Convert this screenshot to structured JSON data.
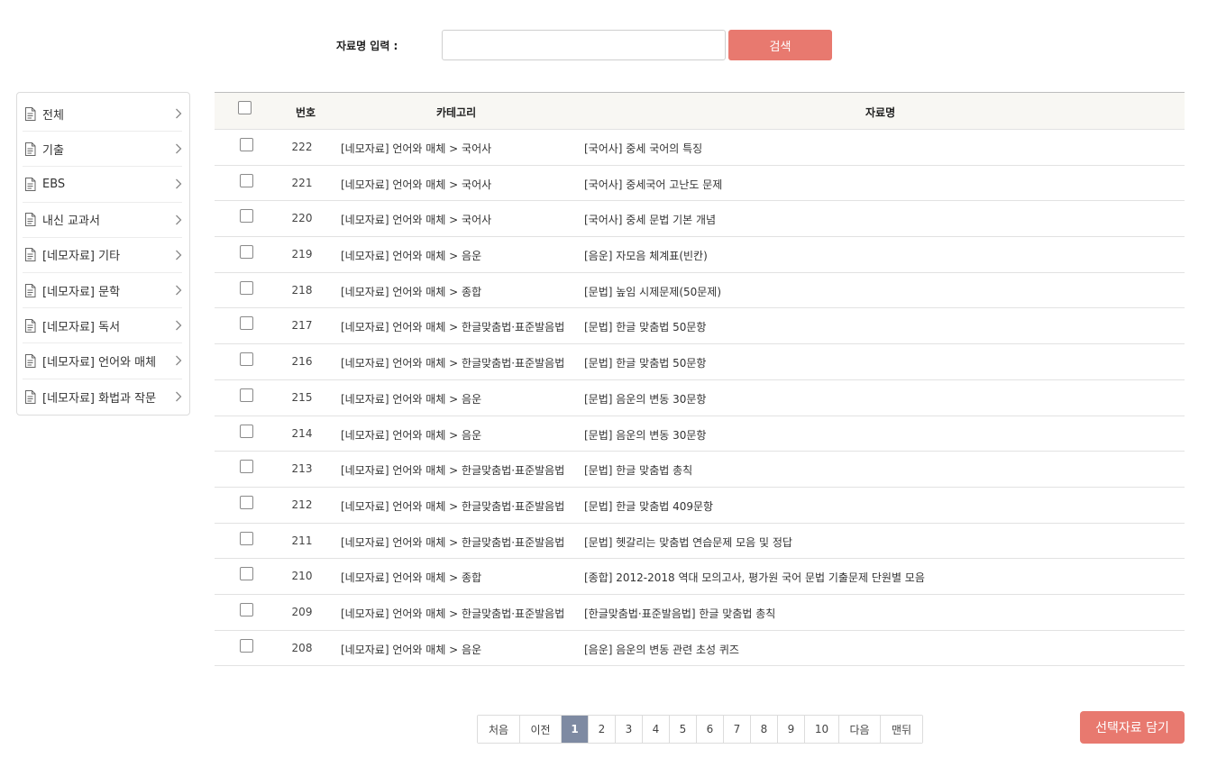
{
  "search": {
    "label": "자료명 입력 :",
    "value": "",
    "placeholder": "",
    "button_label": "검색"
  },
  "sidebar": {
    "items": [
      {
        "label": "전체",
        "icon": "document-icon"
      },
      {
        "label": "기출",
        "icon": "document-icon"
      },
      {
        "label": "EBS",
        "icon": "document-icon"
      },
      {
        "label": "내신 교과서",
        "icon": "document-icon"
      },
      {
        "label": "[네모자료] 기타",
        "icon": "document-icon"
      },
      {
        "label": "[네모자료] 문학",
        "icon": "document-icon"
      },
      {
        "label": "[네모자료] 독서",
        "icon": "document-icon"
      },
      {
        "label": "[네모자료] 언어와 매체",
        "icon": "document-icon"
      },
      {
        "label": "[네모자료] 화법과 작문",
        "icon": "document-icon"
      }
    ]
  },
  "table": {
    "headers": {
      "number": "번호",
      "category": "카테고리",
      "title": "자료명"
    },
    "rows": [
      {
        "number": "222",
        "category": "[네모자료] 언어와 매체 > 국어사",
        "title": "[국어사] 중세 국어의 특징"
      },
      {
        "number": "221",
        "category": "[네모자료] 언어와 매체 > 국어사",
        "title": "[국어사] 중세국어 고난도 문제"
      },
      {
        "number": "220",
        "category": "[네모자료] 언어와 매체 > 국어사",
        "title": "[국어사] 중세 문법 기본 개념"
      },
      {
        "number": "219",
        "category": "[네모자료] 언어와 매체 > 음운",
        "title": "[음운] 자모음 체계표(빈칸)"
      },
      {
        "number": "218",
        "category": "[네모자료] 언어와 매체 > 종합",
        "title": "[문법] 높임 시제문제(50문제)"
      },
      {
        "number": "217",
        "category": "[네모자료] 언어와 매체 > 한글맞춤법·표준발음법",
        "title": "[문법] 한글 맞춤법 50문항"
      },
      {
        "number": "216",
        "category": "[네모자료] 언어와 매체 > 한글맞춤법·표준발음법",
        "title": "[문법] 한글 맞춤법 50문항"
      },
      {
        "number": "215",
        "category": "[네모자료] 언어와 매체 > 음운",
        "title": "[문법] 음운의 변동 30문항"
      },
      {
        "number": "214",
        "category": "[네모자료] 언어와 매체 > 음운",
        "title": "[문법] 음운의 변동 30문항"
      },
      {
        "number": "213",
        "category": "[네모자료] 언어와 매체 > 한글맞춤법·표준발음법",
        "title": "[문법] 한글 맞춤법 총칙"
      },
      {
        "number": "212",
        "category": "[네모자료] 언어와 매체 > 한글맞춤법·표준발음법",
        "title": "[문법] 한글 맞춤법 409문항"
      },
      {
        "number": "211",
        "category": "[네모자료] 언어와 매체 > 한글맞춤법·표준발음법",
        "title": "[문법] 헷갈리는 맞춤법 연습문제 모음 및 정답"
      },
      {
        "number": "210",
        "category": "[네모자료] 언어와 매체 > 종합",
        "title": "[종합] 2012-2018 역대 모의고사, 평가원 국어 문법 기출문제 단원별 모음"
      },
      {
        "number": "209",
        "category": "[네모자료] 언어와 매체 > 한글맞춤법·표준발음법",
        "title": "[한글맞춤법·표준발음법] 한글 맞춤법 총칙"
      },
      {
        "number": "208",
        "category": "[네모자료] 언어와 매체 > 음운",
        "title": "[음운] 음운의 변동 관련 초성 퀴즈"
      }
    ]
  },
  "pagination": {
    "first": "처음",
    "prev": "이전",
    "pages": [
      "1",
      "2",
      "3",
      "4",
      "5",
      "6",
      "7",
      "8",
      "9",
      "10"
    ],
    "current": "1",
    "next": "다음",
    "last": "맨뒤"
  },
  "cart_button_label": "선택자료 담기",
  "colors": {
    "accent": "#e8796f",
    "active_page": "#7e8aa2",
    "header_bg": "#f8f7f3"
  }
}
